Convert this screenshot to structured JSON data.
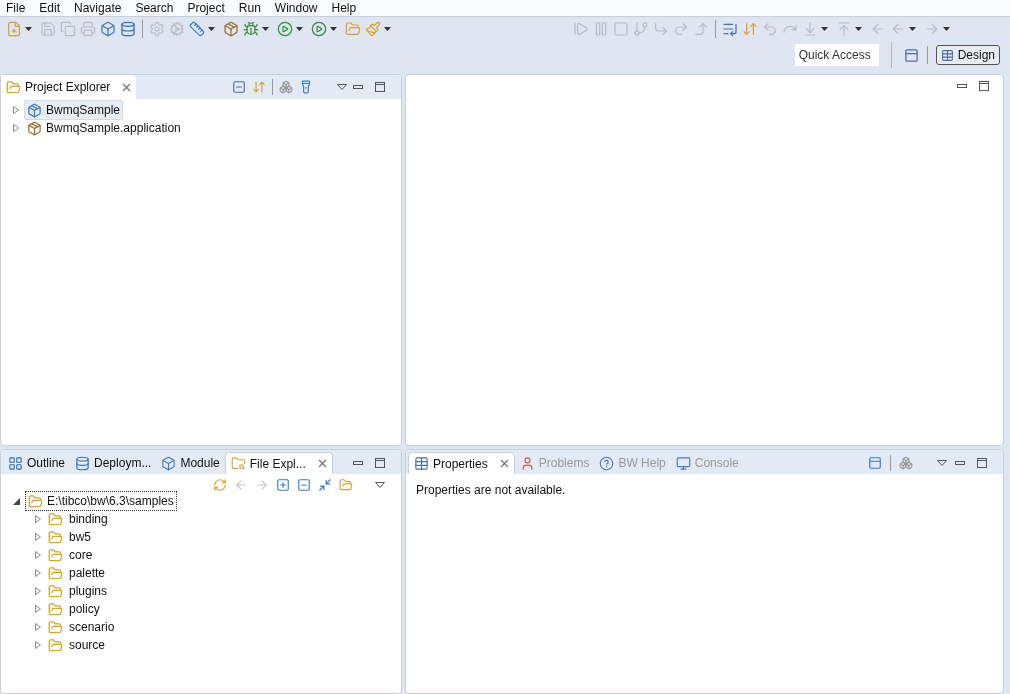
{
  "menu_bar": [
    "File",
    "Edit",
    "Navigate",
    "Search",
    "Project",
    "Run",
    "Window",
    "Help"
  ],
  "toolbar_left": [
    {
      "disabled": false,
      "dropdown": true
    },
    {
      "disabled": true,
      "dropdown": false
    },
    {
      "disabled": true,
      "dropdown": false
    },
    {
      "disabled": true,
      "dropdown": false
    },
    {
      "disabled": false,
      "dropdown": false
    },
    {
      "disabled": false,
      "dropdown": false
    },
    {
      "disabled": true,
      "dropdown": false
    },
    {
      "disabled": true,
      "dropdown": false
    },
    {
      "disabled": false,
      "dropdown": true
    },
    {
      "disabled": false,
      "dropdown": false
    },
    {
      "disabled": false,
      "dropdown": true
    },
    {
      "disabled": false,
      "dropdown": true
    },
    {
      "disabled": false,
      "dropdown": true
    },
    {
      "disabled": false,
      "dropdown": false
    },
    {
      "disabled": false,
      "dropdown": true
    }
  ],
  "toolbar_right": [
    {
      "disabled": true,
      "dropdown": false
    },
    {
      "disabled": true,
      "dropdown": false
    },
    {
      "disabled": true,
      "dropdown": false
    },
    {
      "disabled": true,
      "dropdown": false
    },
    {
      "disabled": true,
      "dropdown": false
    },
    {
      "disabled": true,
      "dropdown": false
    },
    {
      "disabled": true,
      "dropdown": false
    },
    {
      "disabled": false,
      "dropdown": false
    },
    {
      "disabled": false,
      "dropdown": false
    },
    {
      "disabled": true,
      "dropdown": false
    },
    {
      "disabled": true,
      "dropdown": false
    },
    {
      "disabled": true,
      "dropdown": true
    },
    {
      "disabled": true,
      "dropdown": true
    },
    {
      "disabled": true,
      "dropdown": false
    },
    {
      "disabled": true,
      "dropdown": true
    },
    {
      "disabled": true,
      "dropdown": true
    }
  ],
  "quick_access": {
    "placeholder": "Quick Access"
  },
  "perspective": {
    "label": "Design",
    "selected": true
  },
  "project_explorer": {
    "tab": "Project Explorer",
    "items": [
      {
        "label": "BwmqSample",
        "expanded": false,
        "selected": true
      },
      {
        "label": "BwmqSample.application",
        "expanded": false,
        "selected": false
      }
    ]
  },
  "bottom_left_tabs": [
    {
      "label": "Outline",
      "selected": false
    },
    {
      "label": "Deploym...",
      "selected": false
    },
    {
      "label": "Module",
      "selected": false
    },
    {
      "label": "File Expl...",
      "selected": true
    }
  ],
  "file_explorer": {
    "root": {
      "label": "E:\\tibco\\bw\\6.3\\samples",
      "expanded": true,
      "selected": true,
      "children": [
        {
          "label": "binding",
          "expanded": false
        },
        {
          "label": "bw5",
          "expanded": false
        },
        {
          "label": "core",
          "expanded": false
        },
        {
          "label": "palette",
          "expanded": false
        },
        {
          "label": "plugins",
          "expanded": false
        },
        {
          "label": "policy",
          "expanded": false
        },
        {
          "label": "scenario",
          "expanded": false
        },
        {
          "label": "source",
          "expanded": false
        }
      ]
    }
  },
  "bottom_right_tabs": [
    {
      "label": "Properties",
      "selected": true
    },
    {
      "label": "Problems",
      "selected": false
    },
    {
      "label": "BW Help",
      "selected": false
    },
    {
      "label": "Console",
      "selected": false
    }
  ],
  "properties_message": "Properties are not available."
}
